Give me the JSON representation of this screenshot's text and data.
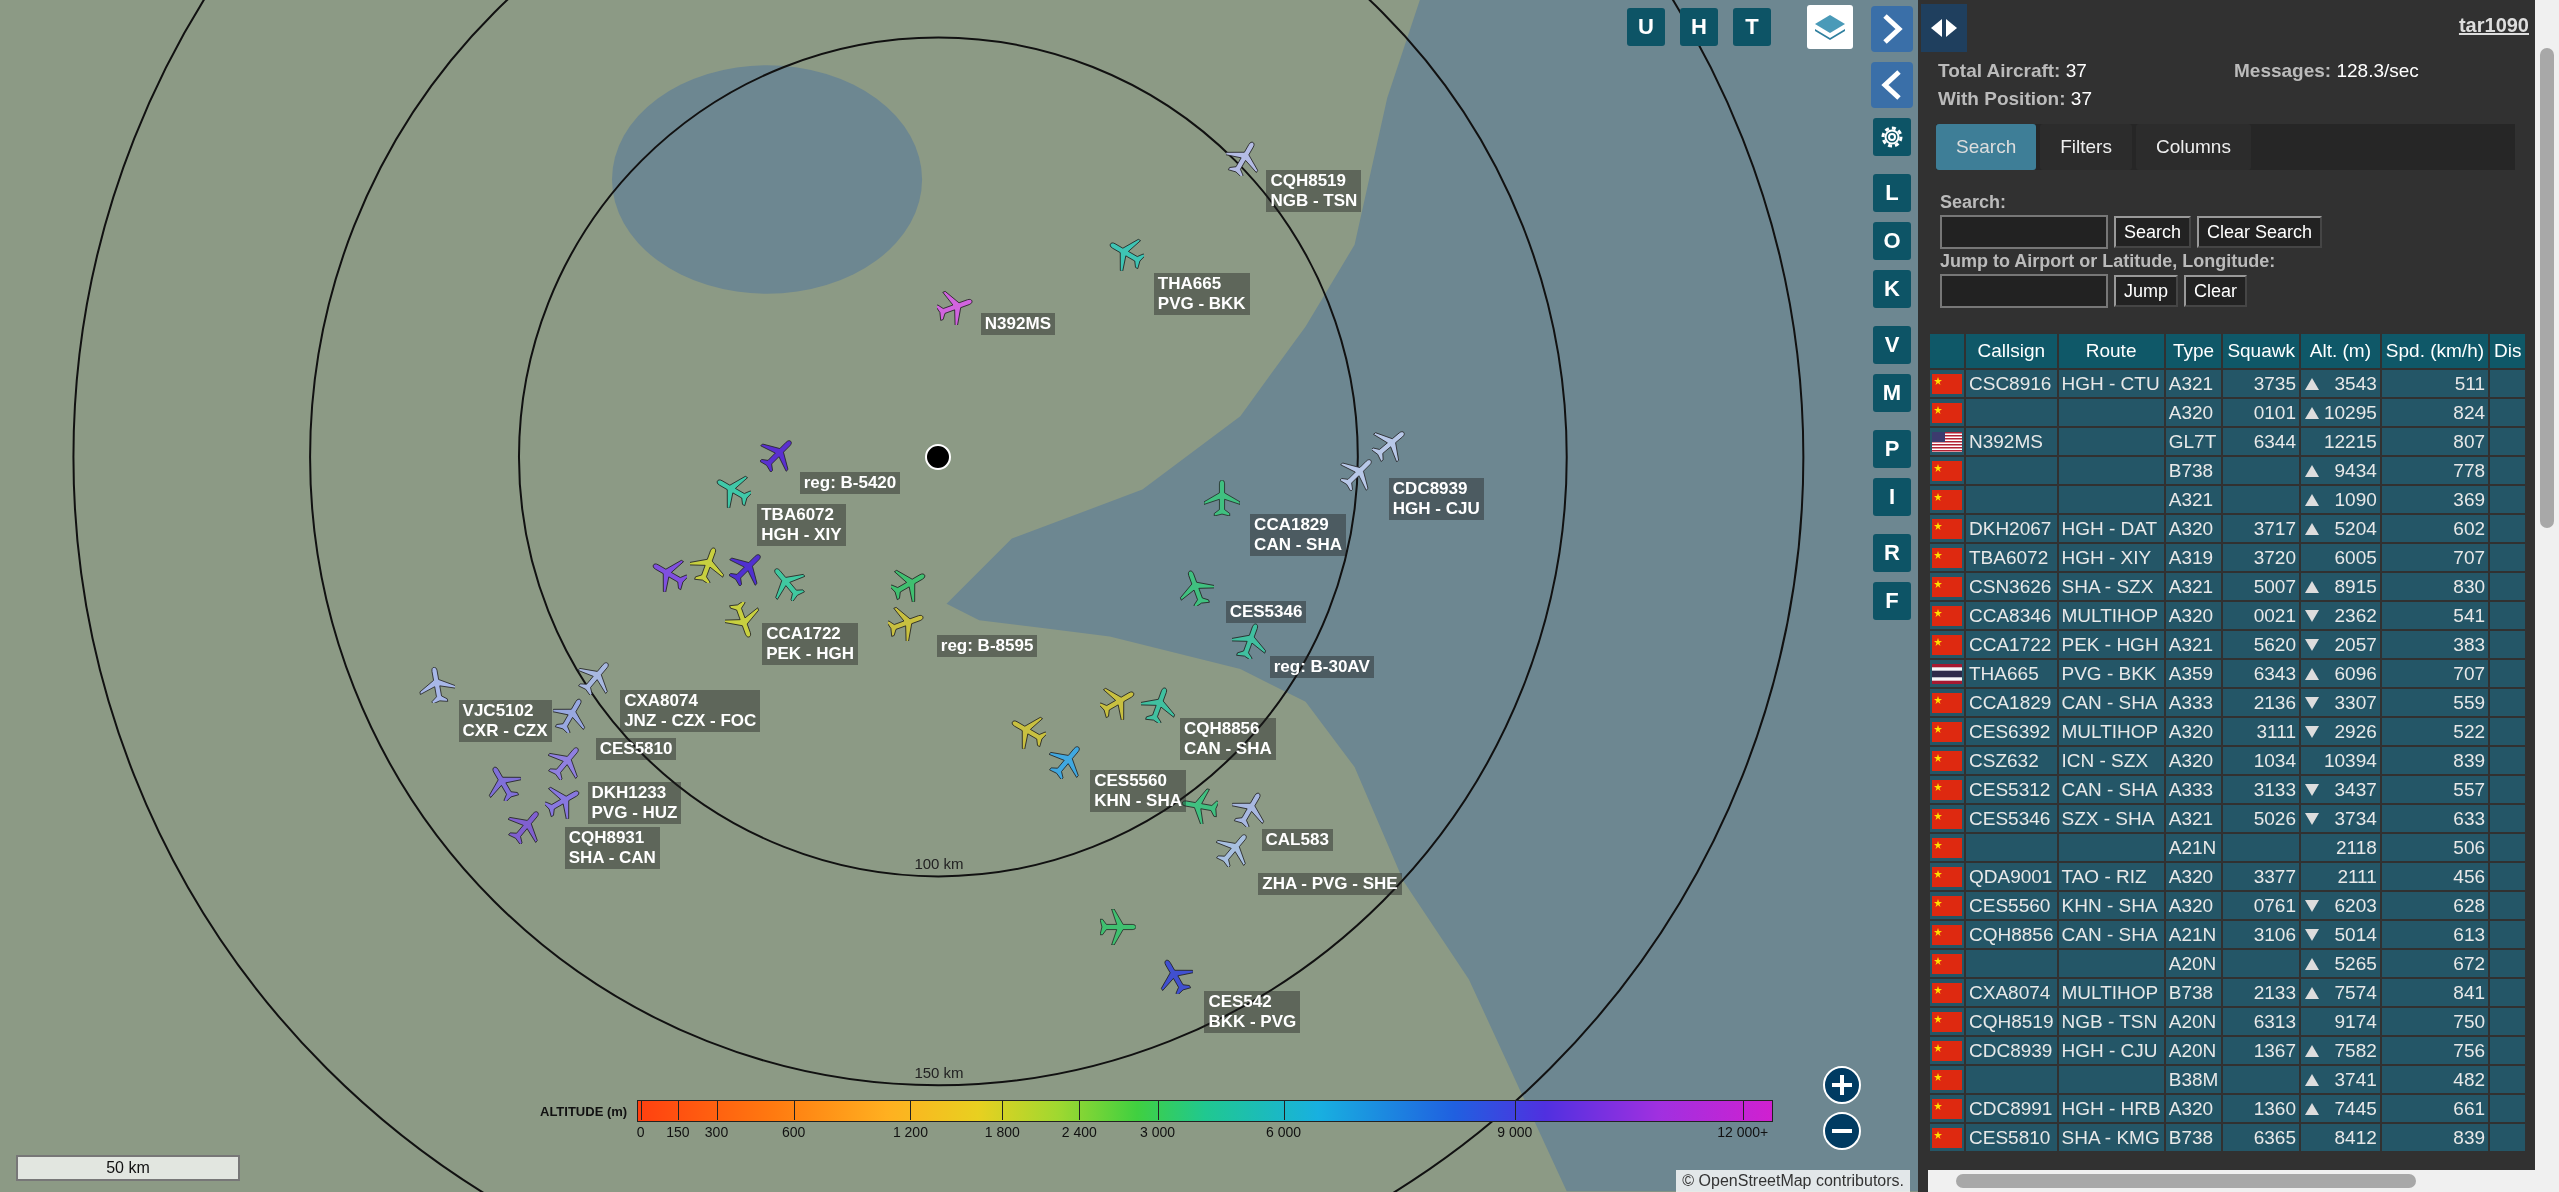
{
  "map": {
    "range_labels": [
      "100 km",
      "150 km"
    ],
    "aircraft": [
      {
        "color": "#b4bce4"
      },
      {
        "color": "#3ec4b4"
      },
      {
        "color": "#d264e0"
      },
      {
        "color": "#5a30d0"
      },
      {
        "color": "#40c8a8"
      },
      {
        "color": "#b8c8e8"
      },
      {
        "color": "#b8c8e8"
      },
      {
        "color": "#40c080"
      },
      {
        "color": "#8050e0"
      },
      {
        "color": "#c8d040"
      },
      {
        "color": "#5030d0"
      },
      {
        "color": "#40c8a0"
      },
      {
        "color": "#c8d040"
      },
      {
        "color": "#40c070"
      },
      {
        "color": "#c8c040"
      },
      {
        "color": "#40c080"
      },
      {
        "color": "#40c0a0"
      },
      {
        "color": "#a8b8e8"
      },
      {
        "color": "#a8b8e0"
      },
      {
        "color": "#98a8e0"
      },
      {
        "color": "#9080e0"
      },
      {
        "color": "#8070d8"
      },
      {
        "color": "#8878e0"
      },
      {
        "color": "#8060d0"
      },
      {
        "color": "#c8c040"
      },
      {
        "color": "#40c0a0"
      },
      {
        "color": "#c8c040"
      },
      {
        "color": "#40a8e0"
      },
      {
        "color": "#40c080"
      },
      {
        "color": "#a8b8e0"
      },
      {
        "color": "#a8c0e0"
      },
      {
        "color": "#40c070"
      },
      {
        "color": "#4050d0"
      }
    ],
    "labels": [
      {
        "lines": [
          "CQH8519",
          "NGB - TSN"
        ]
      },
      {
        "lines": [
          "THA665",
          "PVG - BKK"
        ]
      },
      {
        "lines": [
          "N392MS"
        ]
      },
      {
        "lines": [
          "reg: B-5420"
        ]
      },
      {
        "lines": [
          "TBA6072",
          "HGH - XIY"
        ]
      },
      {
        "lines": [
          "CDC8939",
          "HGH - CJU"
        ]
      },
      {
        "lines": [
          "CCA1829",
          "CAN - SHA"
        ]
      },
      {
        "lines": [
          "CCA1722",
          "PEK - HGH"
        ]
      },
      {
        "lines": [
          "reg: B-8595"
        ]
      },
      {
        "lines": [
          "CES5346"
        ]
      },
      {
        "lines": [
          "reg: B-30AV"
        ]
      },
      {
        "lines": [
          "VJC5102",
          "CXR - CZX"
        ]
      },
      {
        "lines": [
          "CXA8074",
          "JNZ - CZX - FOC"
        ]
      },
      {
        "lines": [
          "CES5810"
        ]
      },
      {
        "lines": [
          "DKH1233",
          "PVG - HUZ"
        ]
      },
      {
        "lines": [
          "CQH8931",
          "SHA - CAN"
        ]
      },
      {
        "lines": [
          "CQH8856",
          "CAN - SHA"
        ]
      },
      {
        "lines": [
          "CES5560",
          "KHN - SHA"
        ]
      },
      {
        "lines": [
          "CAL583"
        ]
      },
      {
        "lines": [
          "ZHA - PVG - SHE"
        ]
      },
      {
        "lines": [
          "CES542",
          "BKK - PVG"
        ]
      }
    ],
    "top_buttons": [
      "U",
      "H",
      "T"
    ],
    "side_buttons": [
      [
        "L",
        "O",
        "K"
      ],
      [
        "V",
        "M"
      ],
      [
        "P",
        "I"
      ],
      [
        "R",
        "F"
      ]
    ],
    "legend": {
      "title": "ALTITUDE (m)",
      "ticks": [
        "0",
        "150",
        "300",
        "600",
        "1 200",
        "1 800",
        "2 400",
        "3 000",
        "6 000",
        "9 000",
        "12 000+"
      ]
    },
    "scale": "50 km",
    "attribution": "© OpenStreetMap contributors."
  },
  "panel": {
    "brand": "tar1090",
    "stats": [
      {
        "label": "Total Aircraft:",
        "value": "37"
      },
      {
        "label": "Messages:",
        "value": "128.3/sec"
      },
      {
        "label": "With Position:",
        "value": "37"
      }
    ],
    "tabs": [
      {
        "label": "Search",
        "selected": true
      },
      {
        "label": "Filters",
        "selected": false
      },
      {
        "label": "Columns",
        "selected": false
      }
    ],
    "search": {
      "label": "Search:",
      "buttons": [
        "Search",
        "Clear Search"
      ]
    },
    "jump": {
      "label": "Jump to Airport or Latitude, Longitude:",
      "buttons": [
        "Jump",
        "Clear"
      ]
    },
    "table": {
      "columns": [
        "",
        "Callsign",
        "Route",
        "Type",
        "Squawk",
        "Alt. (m)",
        "Spd. (km/h)",
        "Dis"
      ],
      "rows": [
        {
          "flag": {
            "kind": "cn"
          },
          "callsign": "CSC8916",
          "route": "HGH - CTU",
          "type": "A321",
          "squawk": "3735",
          "climbing": true,
          "descending": false,
          "alt": "3543",
          "speed": "511"
        },
        {
          "flag": {
            "kind": "cn"
          },
          "callsign": "",
          "route": "",
          "type": "A320",
          "squawk": "0101",
          "climbing": true,
          "descending": false,
          "alt": "10295",
          "speed": "824"
        },
        {
          "flag": {
            "kind": "us"
          },
          "callsign": "N392MS",
          "route": "",
          "type": "GL7T",
          "squawk": "6344",
          "climbing": false,
          "descending": false,
          "alt": "12215",
          "speed": "807"
        },
        {
          "flag": {
            "kind": "cn"
          },
          "callsign": "",
          "route": "",
          "type": "B738",
          "squawk": "",
          "climbing": true,
          "descending": false,
          "alt": "9434",
          "speed": "778"
        },
        {
          "flag": {
            "kind": "cn"
          },
          "callsign": "",
          "route": "",
          "type": "A321",
          "squawk": "",
          "climbing": true,
          "descending": false,
          "alt": "1090",
          "speed": "369"
        },
        {
          "flag": {
            "kind": "cn"
          },
          "callsign": "DKH2067",
          "route": "HGH - DAT",
          "type": "A320",
          "squawk": "3717",
          "climbing": true,
          "descending": false,
          "alt": "5204",
          "speed": "602"
        },
        {
          "flag": {
            "kind": "cn"
          },
          "callsign": "TBA6072",
          "route": "HGH - XIY",
          "type": "A319",
          "squawk": "3720",
          "climbing": false,
          "descending": false,
          "alt": "6005",
          "speed": "707"
        },
        {
          "flag": {
            "kind": "cn"
          },
          "callsign": "CSN3626",
          "route": "SHA - SZX",
          "type": "A321",
          "squawk": "5007",
          "climbing": true,
          "descending": false,
          "alt": "8915",
          "speed": "830"
        },
        {
          "flag": {
            "kind": "cn"
          },
          "callsign": "CCA8346",
          "route": "MULTIHOP",
          "type": "A320",
          "squawk": "0021",
          "climbing": false,
          "descending": true,
          "alt": "2362",
          "speed": "541"
        },
        {
          "flag": {
            "kind": "cn"
          },
          "callsign": "CCA1722",
          "route": "PEK - HGH",
          "type": "A321",
          "squawk": "5620",
          "climbing": false,
          "descending": true,
          "alt": "2057",
          "speed": "383"
        },
        {
          "flag": {
            "kind": "th"
          },
          "callsign": "THA665",
          "route": "PVG - BKK",
          "type": "A359",
          "squawk": "6343",
          "climbing": true,
          "descending": false,
          "alt": "6096",
          "speed": "707"
        },
        {
          "flag": {
            "kind": "cn"
          },
          "callsign": "CCA1829",
          "route": "CAN - SHA",
          "type": "A333",
          "squawk": "2136",
          "climbing": false,
          "descending": true,
          "alt": "3307",
          "speed": "559"
        },
        {
          "flag": {
            "kind": "cn"
          },
          "callsign": "CES6392",
          "route": "MULTIHOP",
          "type": "A320",
          "squawk": "3111",
          "climbing": false,
          "descending": true,
          "alt": "2926",
          "speed": "522"
        },
        {
          "flag": {
            "kind": "cn"
          },
          "callsign": "CSZ632",
          "route": "ICN - SZX",
          "type": "A320",
          "squawk": "1034",
          "climbing": false,
          "descending": false,
          "alt": "10394",
          "speed": "839"
        },
        {
          "flag": {
            "kind": "cn"
          },
          "callsign": "CES5312",
          "route": "CAN - SHA",
          "type": "A333",
          "squawk": "3133",
          "climbing": false,
          "descending": true,
          "alt": "3437",
          "speed": "557"
        },
        {
          "flag": {
            "kind": "cn"
          },
          "callsign": "CES5346",
          "route": "SZX - SHA",
          "type": "A321",
          "squawk": "5026",
          "climbing": false,
          "descending": true,
          "alt": "3734",
          "speed": "633"
        },
        {
          "flag": {
            "kind": "cn"
          },
          "callsign": "",
          "route": "",
          "type": "A21N",
          "squawk": "",
          "climbing": false,
          "descending": false,
          "alt": "2118",
          "speed": "506"
        },
        {
          "flag": {
            "kind": "cn"
          },
          "callsign": "QDA9001",
          "route": "TAO - RIZ",
          "type": "A320",
          "squawk": "3377",
          "climbing": false,
          "descending": false,
          "alt": "2111",
          "speed": "456"
        },
        {
          "flag": {
            "kind": "cn"
          },
          "callsign": "CES5560",
          "route": "KHN - SHA",
          "type": "A320",
          "squawk": "0761",
          "climbing": false,
          "descending": true,
          "alt": "6203",
          "speed": "628"
        },
        {
          "flag": {
            "kind": "cn"
          },
          "callsign": "CQH8856",
          "route": "CAN - SHA",
          "type": "A21N",
          "squawk": "3106",
          "climbing": false,
          "descending": true,
          "alt": "5014",
          "speed": "613"
        },
        {
          "flag": {
            "kind": "cn"
          },
          "callsign": "",
          "route": "",
          "type": "A20N",
          "squawk": "",
          "climbing": true,
          "descending": false,
          "alt": "5265",
          "speed": "672"
        },
        {
          "flag": {
            "kind": "cn"
          },
          "callsign": "CXA8074",
          "route": "MULTIHOP",
          "type": "B738",
          "squawk": "2133",
          "climbing": true,
          "descending": false,
          "alt": "7574",
          "speed": "841"
        },
        {
          "flag": {
            "kind": "cn"
          },
          "callsign": "CQH8519",
          "route": "NGB - TSN",
          "type": "A20N",
          "squawk": "6313",
          "climbing": false,
          "descending": false,
          "alt": "9174",
          "speed": "750"
        },
        {
          "flag": {
            "kind": "cn"
          },
          "callsign": "CDC8939",
          "route": "HGH - CJU",
          "type": "A20N",
          "squawk": "1367",
          "climbing": true,
          "descending": false,
          "alt": "7582",
          "speed": "756"
        },
        {
          "flag": {
            "kind": "cn"
          },
          "callsign": "",
          "route": "",
          "type": "B38M",
          "squawk": "",
          "climbing": true,
          "descending": false,
          "alt": "3741",
          "speed": "482"
        },
        {
          "flag": {
            "kind": "cn"
          },
          "callsign": "CDC8991",
          "route": "HGH - HRB",
          "type": "A320",
          "squawk": "1360",
          "climbing": true,
          "descending": false,
          "alt": "7445",
          "speed": "661"
        },
        {
          "flag": {
            "kind": "cn"
          },
          "callsign": "CES5810",
          "route": "SHA - KMG",
          "type": "B738",
          "squawk": "6365",
          "climbing": false,
          "descending": false,
          "alt": "8412",
          "speed": "839"
        }
      ]
    }
  }
}
